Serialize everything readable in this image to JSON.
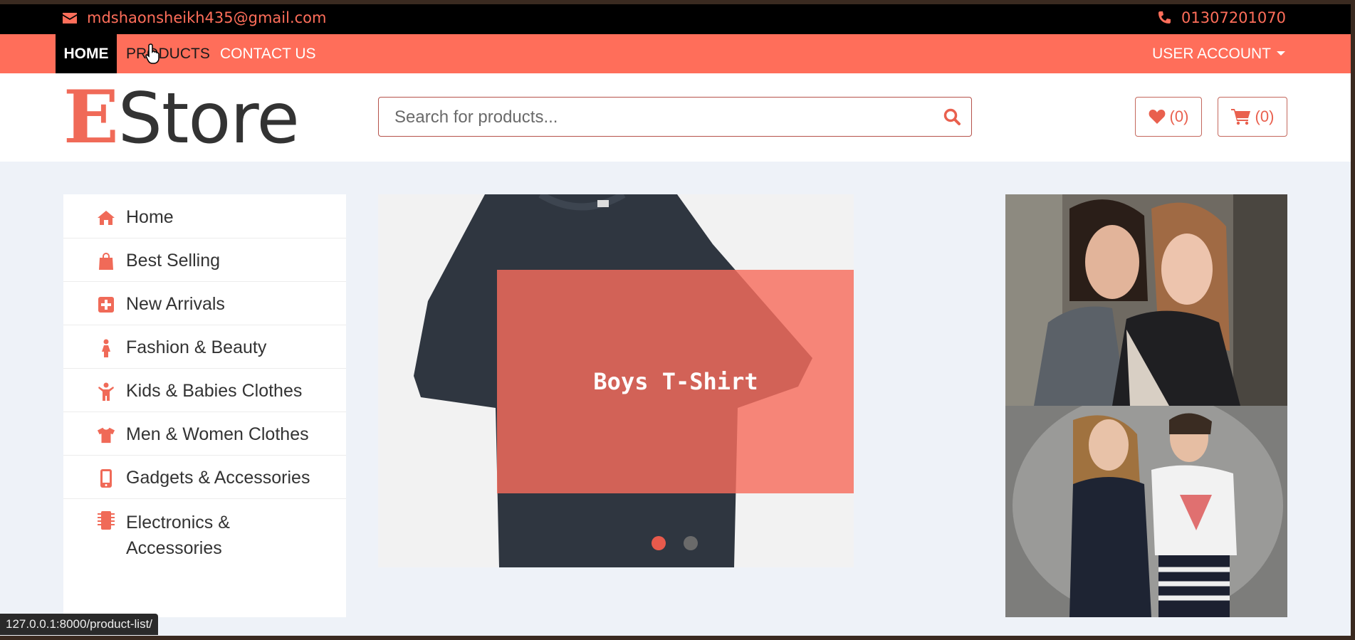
{
  "topbar": {
    "email": "mdshaonsheikh435@gmail.com",
    "phone": "01307201070"
  },
  "nav": {
    "home": "HOME",
    "products": "PRODUCTS",
    "contact": "CONTACT US",
    "account": "USER ACCOUNT"
  },
  "header": {
    "logo_initial": "E",
    "logo_rest": "Store",
    "search_placeholder": "Search for products...",
    "wishlist_count": "(0)",
    "cart_count": "(0)"
  },
  "sidebar": {
    "items": [
      {
        "label": "Home",
        "icon": "home-icon"
      },
      {
        "label": "Best Selling",
        "icon": "shopping-bag-icon"
      },
      {
        "label": "New Arrivals",
        "icon": "plus-square-icon"
      },
      {
        "label": "Fashion & Beauty",
        "icon": "female-icon"
      },
      {
        "label": "Kids & Babies Clothes",
        "icon": "child-icon"
      },
      {
        "label": "Men & Women Clothes",
        "icon": "tshirt-icon"
      },
      {
        "label": "Gadgets & Accessories",
        "icon": "mobile-icon"
      },
      {
        "label": "Electronics & Accessories",
        "icon": "microchip-icon"
      }
    ]
  },
  "carousel": {
    "caption": "Boys T-Shirt",
    "active_slide": 1,
    "slide_count": 2
  },
  "status_url": "127.0.0.1:8000/product-list/",
  "colors": {
    "accent": "#ff6e5a",
    "topbar": "#000000",
    "page_bg": "#eef2f8"
  }
}
